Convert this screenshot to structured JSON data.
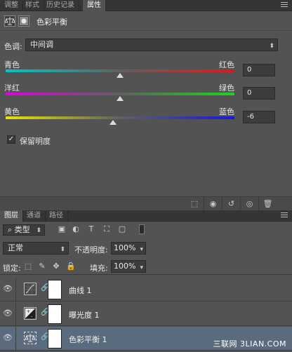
{
  "top_tabs": [
    "调整",
    "样式",
    "历史记录",
    "属性"
  ],
  "properties": {
    "title": "色彩平衡",
    "tone_label": "色调:",
    "tone_value": "中间调",
    "sliders": [
      {
        "left": "青色",
        "right": "红色",
        "value": "0",
        "position": 0.5
      },
      {
        "left": "洋红",
        "right": "绿色",
        "value": "0",
        "position": 0.5
      },
      {
        "left": "黄色",
        "right": "蓝色",
        "value": "-6",
        "position": 0.47
      }
    ],
    "preserve_label": "保留明度",
    "preserve_checked": "✓"
  },
  "layers_tabs": [
    "图层",
    "通道",
    "路径"
  ],
  "filter": {
    "type_label": "类型"
  },
  "blend": {
    "mode": "正常",
    "opacity_label": "不透明度:",
    "opacity": "100%"
  },
  "lock": {
    "label": "锁定:",
    "fill_label": "填充:",
    "fill": "100%"
  },
  "layers": [
    {
      "name": "曲线 1",
      "icon": "curves-icon",
      "selected": false
    },
    {
      "name": "曝光度 1",
      "icon": "exposure-icon",
      "selected": false
    },
    {
      "name": "色彩平衡 1",
      "icon": "balance-icon",
      "selected": true
    }
  ],
  "watermark": "三联网 3LIAN.COM"
}
